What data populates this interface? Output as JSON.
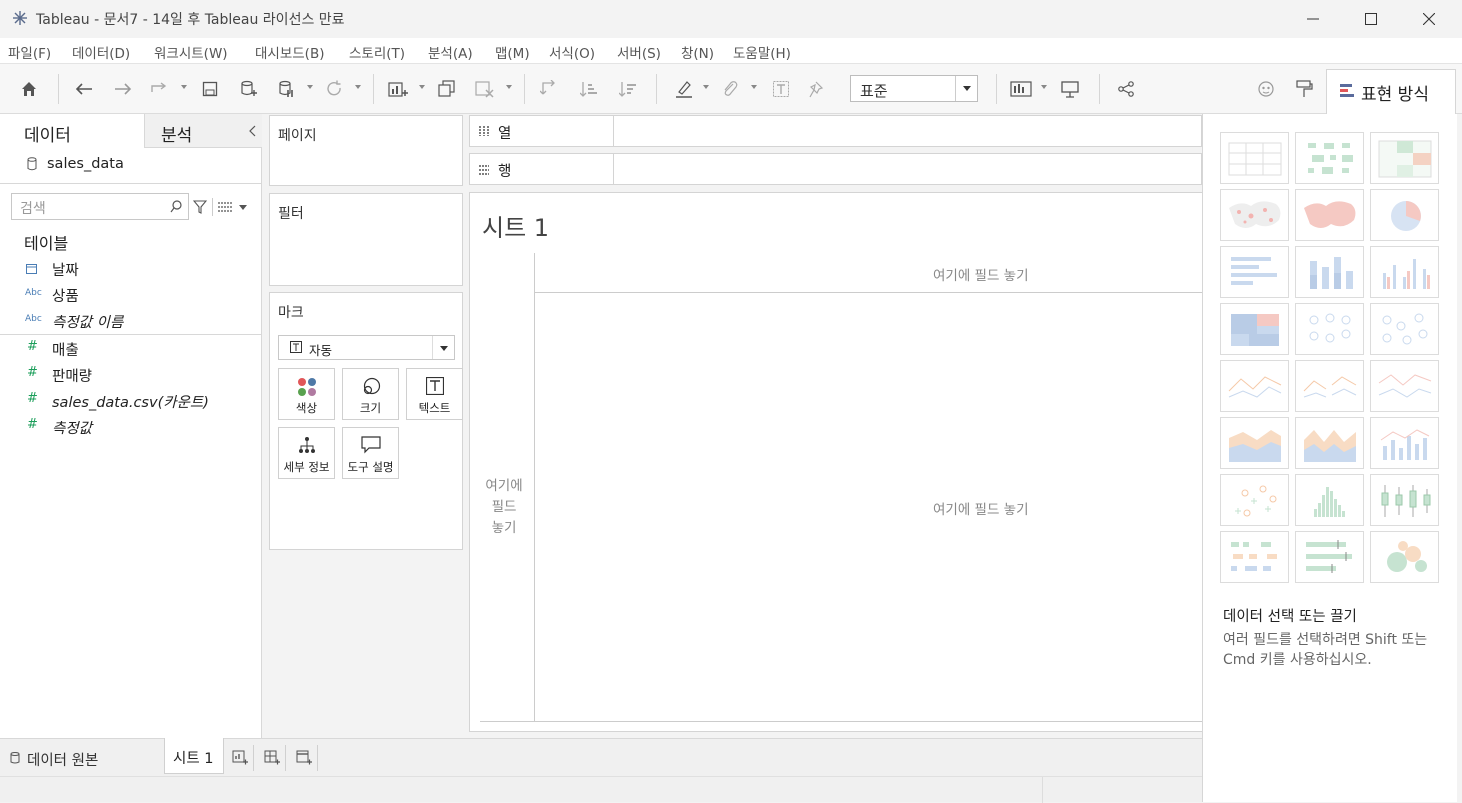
{
  "window": {
    "title": "Tableau - 문서7 - 14일 후 Tableau 라이선스 만료"
  },
  "menu": [
    "파일(F)",
    "데이터(D)",
    "워크시트(W)",
    "대시보드(B)",
    "스토리(T)",
    "분석(A)",
    "맵(M)",
    "서식(O)",
    "서버(S)",
    "창(N)",
    "도움말(H)"
  ],
  "toolbar": {
    "fit_value": "표준",
    "show_me_label": "표현 방식"
  },
  "data_pane": {
    "tab_data": "데이터",
    "tab_analytics": "분석",
    "datasource": "sales_data",
    "search_placeholder": "검색",
    "tables_header": "테이블",
    "dimensions": [
      {
        "icon": "date",
        "name": "날짜"
      },
      {
        "icon": "Abc",
        "name": "상품"
      },
      {
        "icon": "Abc",
        "name": "측정값 이름"
      }
    ],
    "measures": [
      {
        "icon": "#",
        "name": "매출"
      },
      {
        "icon": "#",
        "name": "판매량"
      },
      {
        "icon": "#",
        "name": "sales_data.csv(카운트)"
      },
      {
        "icon": "#",
        "name": "측정값"
      }
    ]
  },
  "cards": {
    "pages": "페이지",
    "filters": "필터",
    "marks": "마크",
    "mark_type": "자동",
    "mark_buttons": [
      "색상",
      "크기",
      "텍스트",
      "세부 정보",
      "도구 설명"
    ]
  },
  "shelves": {
    "columns": "열",
    "rows": "행"
  },
  "canvas": {
    "sheet_title": "시트 1",
    "drop_columns": "여기에 필드 놓기",
    "drop_rows": "여기에\n필드\n놓기",
    "drop_center": "여기에 필드 놓기"
  },
  "show_me": {
    "hint_title": "데이터 선택 또는 끌기",
    "hint_body": "여러 필드를 선택하려면 Shift 또는 Cmd 키를 사용하십시오."
  },
  "tabs": {
    "datasource": "데이터 원본",
    "sheet": "시트 1"
  },
  "colors": {
    "accent_blue": "#4a7db5",
    "measure_green": "#1b9e5a"
  }
}
